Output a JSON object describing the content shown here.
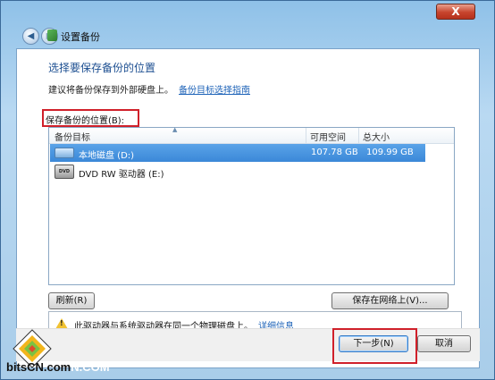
{
  "window": {
    "title": "设置备份",
    "close_label": "X"
  },
  "main": {
    "heading": "选择要保存备份的位置",
    "advice_text": "建议将备份保存到外部硬盘上。",
    "advice_link": "备份目标选择指南",
    "location_label": "保存备份的位置(B):"
  },
  "table": {
    "columns": [
      "备份目标",
      "可用空间",
      "总大小"
    ],
    "rows": [
      {
        "name": "本地磁盘 (D:)",
        "free": "107.78 GB",
        "total": "109.99 GB",
        "icon": "hard-drive-icon",
        "selected": true
      },
      {
        "name": "DVD RW 驱动器 (E:)",
        "free": "",
        "total": "",
        "icon": "dvd-drive-icon",
        "selected": false
      }
    ],
    "dvd_icon_text": "DVD"
  },
  "buttons": {
    "refresh": "刷新(R)",
    "save_network": "保存在网络上(V)...",
    "next": "下一步(N)",
    "cancel": "取消"
  },
  "warning": {
    "text": "此驱动器与系统驱动器在同一个物理磁盘上。",
    "link": "详细信息"
  },
  "watermark": {
    "text_main": "bitsCN.com",
    "text_ghost": "N.COM"
  },
  "colors": {
    "highlight": "#d0202a",
    "selection": "#3b88d8",
    "link": "#1e63b8"
  }
}
